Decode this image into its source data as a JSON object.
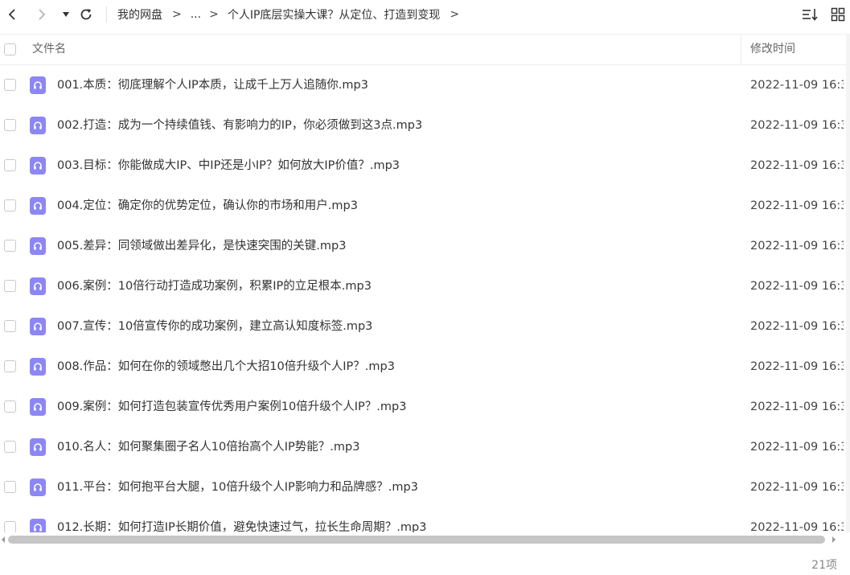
{
  "toolbar": {
    "breadcrumb": {
      "root": "我的网盘",
      "separator": ">",
      "ellipsis": "...",
      "current": "个人IP底层实操大课？从定位、打造到变现"
    }
  },
  "table": {
    "columns": {
      "name": "文件名",
      "modified": "修改时间"
    },
    "rows": [
      {
        "name": "001.本质：彻底理解个人IP本质，让成千上万人追随你.mp3",
        "modified": "2022-11-09 16:3"
      },
      {
        "name": "002.打造：成为一个持续值钱、有影响力的IP，你必须做到这3点.mp3",
        "modified": "2022-11-09 16:3"
      },
      {
        "name": "003.目标：你能做成大IP、中IP还是小IP？如何放大IP价值？.mp3",
        "modified": "2022-11-09 16:3"
      },
      {
        "name": "004.定位：确定你的优势定位，确认你的市场和用户.mp3",
        "modified": "2022-11-09 16:3"
      },
      {
        "name": "005.差异：同领域做出差异化，是快速突围的关键.mp3",
        "modified": "2022-11-09 16:3"
      },
      {
        "name": "006.案例：10倍行动打造成功案例，积累IP的立足根本.mp3",
        "modified": "2022-11-09 16:3"
      },
      {
        "name": "007.宣传：10倍宣传你的成功案例，建立高认知度标签.mp3",
        "modified": "2022-11-09 16:3"
      },
      {
        "name": "008.作品：如何在你的领域憋出几个大招10倍升级个人IP？.mp3",
        "modified": "2022-11-09 16:3"
      },
      {
        "name": "009.案例：如何打造包装宣传优秀用户案例10倍升级个人IP？.mp3",
        "modified": "2022-11-09 16:3"
      },
      {
        "name": "010.名人：如何聚集圈子名人10倍抬高个人IP势能？.mp3",
        "modified": "2022-11-09 16:3"
      },
      {
        "name": "011.平台：如何抱平台大腿，10倍升级个人IP影响力和品牌感？.mp3",
        "modified": "2022-11-09 16:3"
      },
      {
        "name": "012.长期：如何打造IP长期价值，避免快速过气，拉长生命周期？.mp3",
        "modified": "2022-11-09 16:3"
      }
    ]
  },
  "footer": {
    "count": "21项"
  },
  "icons": {
    "back": "chevron-left-icon",
    "forward": "chevron-right-icon",
    "history": "caret-down-icon",
    "refresh": "refresh-icon",
    "sort": "sort-icon",
    "grid": "grid-view-icon",
    "file": "audio-file-icon"
  },
  "colors": {
    "file_icon": "#8c87f5",
    "scroll_thumb": "#c6c6c6"
  }
}
